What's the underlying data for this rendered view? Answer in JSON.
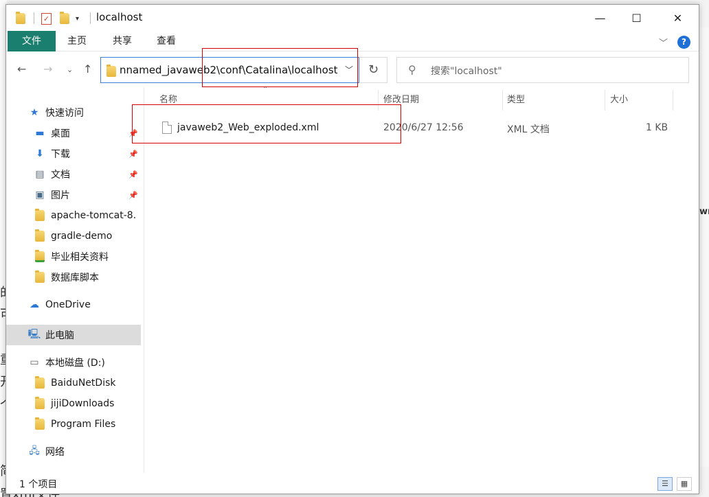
{
  "window": {
    "title": "localhost"
  },
  "ribbon": {
    "tabs": [
      "文件",
      "主页",
      "共享",
      "查看"
    ],
    "help": "?"
  },
  "window_controls": {
    "minimize": "—",
    "maximize": "☐",
    "close": "✕"
  },
  "address": {
    "path": "nnamed_javaweb2\\conf\\Catalina\\localhost",
    "search_placeholder": "搜索\"localhost\""
  },
  "sidebar": {
    "quick_access": "快速访问",
    "quick_items": [
      {
        "label": "桌面",
        "icon": "desktop-icon",
        "pinned": true
      },
      {
        "label": "下载",
        "icon": "download-icon",
        "pinned": true
      },
      {
        "label": "文档",
        "icon": "documents-icon",
        "pinned": true
      },
      {
        "label": "图片",
        "icon": "pictures-icon",
        "pinned": true
      },
      {
        "label": "apache-tomcat-8.",
        "icon": "folder-icon",
        "pinned": false
      },
      {
        "label": "gradle-demo",
        "icon": "folder-icon",
        "pinned": false
      },
      {
        "label": "毕业相关资料",
        "icon": "folder-icon",
        "pinned": false
      },
      {
        "label": "数据库脚本",
        "icon": "folder-icon",
        "pinned": false
      }
    ],
    "onedrive": "OneDrive",
    "this_pc": "此电脑",
    "drive": "本地磁盘 (D:)",
    "drive_items": [
      "BaiduNetDisk",
      "jijiDownloads",
      "Program Files"
    ],
    "network": "网络"
  },
  "columns": {
    "name": "名称",
    "date": "修改日期",
    "type": "类型",
    "size": "大小"
  },
  "files": [
    {
      "name": "javaweb2_Web_exploded.xml",
      "date": "2020/6/27 12:56",
      "type": "XML 文档",
      "size": "1 KB"
    }
  ],
  "status": {
    "count": "1 个项目"
  },
  "background_text": {
    "bottom": "置xml文件",
    "right_bold": "wr"
  }
}
